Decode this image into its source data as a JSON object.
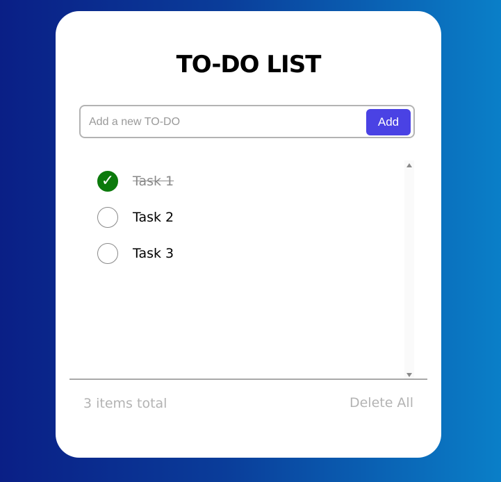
{
  "title": "TO-DO LIST",
  "input": {
    "value": "",
    "placeholder": "Add a new TO-DO"
  },
  "add_button_label": "Add",
  "tasks": [
    {
      "label": "Task 1",
      "completed": true,
      "check_glyph": "✓"
    },
    {
      "label": "Task 2",
      "completed": false,
      "check_glyph": ""
    },
    {
      "label": "Task 3",
      "completed": false,
      "check_glyph": ""
    }
  ],
  "footer": {
    "total_text": "3 items total",
    "delete_all_label": "Delete All"
  },
  "colors": {
    "accent": "#4a42e4",
    "checked": "#0c7a0c",
    "muted_text": "#b3b3b3"
  },
  "icons": {
    "checked": "check-icon",
    "scroll_up": "scroll-up-arrow-icon",
    "scroll_down": "scroll-down-arrow-icon"
  }
}
